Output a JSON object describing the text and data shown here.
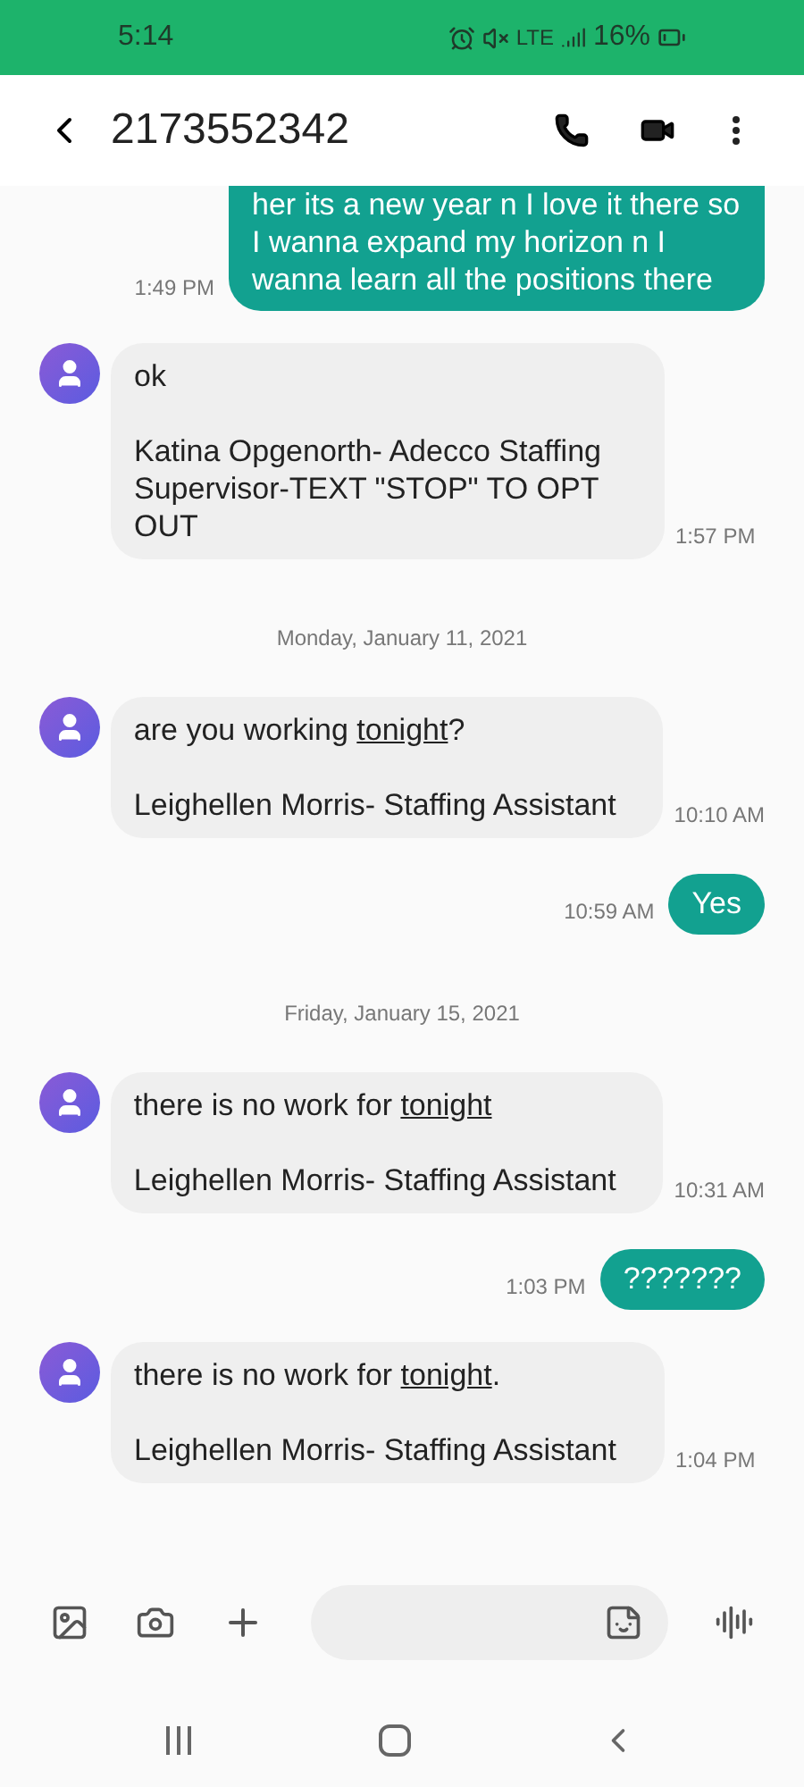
{
  "status_bar": {
    "time": "5:14",
    "network": "LTE",
    "battery": "16%"
  },
  "header": {
    "title": "2173552342"
  },
  "messages": [
    {
      "kind": "sent",
      "time": "1:49 PM",
      "cut_top": true,
      "paragraphs": [
        [
          {
            "text": "her its a new year n I love it there so I wanna expand my horizon n I wanna learn all the positions there"
          }
        ]
      ]
    },
    {
      "kind": "received",
      "time": "1:57 PM",
      "paragraphs": [
        [
          {
            "text": "ok"
          }
        ],
        [
          {
            "text": "Katina Opgenorth- Adecco Staffing Supervisor-TEXT \"STOP\" TO OPT OUT"
          }
        ]
      ]
    },
    {
      "kind": "date",
      "text": "Monday, January 11, 2021"
    },
    {
      "kind": "received",
      "time": "10:10 AM",
      "paragraphs": [
        [
          {
            "text": "are you working "
          },
          {
            "text": "tonight",
            "link": true
          },
          {
            "text": "?"
          }
        ],
        [
          {
            "text": "Leighellen Morris- Staffing Assistant"
          }
        ]
      ]
    },
    {
      "kind": "sent",
      "time": "10:59 AM",
      "cut_top": false,
      "paragraphs": [
        [
          {
            "text": "Yes"
          }
        ]
      ]
    },
    {
      "kind": "date",
      "text": "Friday, January 15, 2021"
    },
    {
      "kind": "received",
      "time": "10:31 AM",
      "paragraphs": [
        [
          {
            "text": "there is no work for "
          },
          {
            "text": "tonight",
            "link": true
          }
        ],
        [
          {
            "text": "Leighellen Morris- Staffing Assistant"
          }
        ]
      ]
    },
    {
      "kind": "sent",
      "time": "1:03 PM",
      "cut_top": false,
      "paragraphs": [
        [
          {
            "text": "???????"
          }
        ]
      ]
    },
    {
      "kind": "received",
      "time": "1:04 PM",
      "paragraphs": [
        [
          {
            "text": "there is no work for "
          },
          {
            "text": "tonight",
            "link": true
          },
          {
            "text": "."
          }
        ],
        [
          {
            "text": "Leighellen Morris- Staffing Assistant"
          }
        ]
      ]
    }
  ]
}
